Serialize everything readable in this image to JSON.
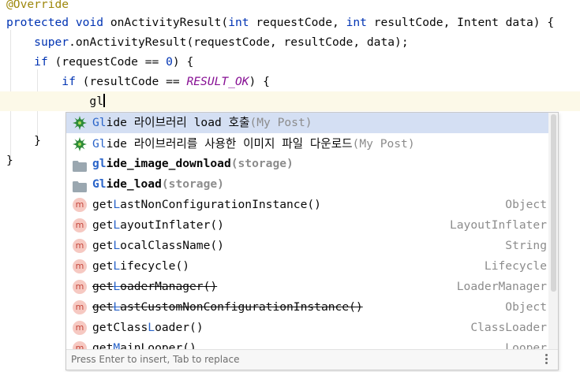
{
  "editor": {
    "lines": [
      {
        "parts": [
          {
            "t": "@Override",
            "c": "ann"
          }
        ]
      },
      {
        "parts": [
          {
            "t": "protected",
            "c": "kw"
          },
          {
            "t": " "
          },
          {
            "t": "void",
            "c": "kw"
          },
          {
            "t": " onActivityResult("
          },
          {
            "t": "int",
            "c": "kw"
          },
          {
            "t": " requestCode, "
          },
          {
            "t": "int",
            "c": "kw"
          },
          {
            "t": " resultCode, Intent data) {"
          }
        ]
      },
      {
        "parts": [
          {
            "t": "    "
          },
          {
            "t": "super",
            "c": "kw"
          },
          {
            "t": ".onActivityResult(requestCode, resultCode, data);"
          }
        ]
      },
      {
        "parts": [
          {
            "t": "    "
          },
          {
            "t": "if",
            "c": "kw"
          },
          {
            "t": " (requestCode == "
          },
          {
            "t": "0",
            "c": "kw"
          },
          {
            "t": ") {"
          }
        ]
      },
      {
        "parts": [
          {
            "t": "        "
          },
          {
            "t": "if",
            "c": "kw"
          },
          {
            "t": " (resultCode == "
          },
          {
            "t": "RESULT_OK",
            "c": "const"
          },
          {
            "t": ") {"
          }
        ]
      },
      {
        "parts": [
          {
            "t": "            gl"
          }
        ],
        "caret": true,
        "current": true
      },
      {
        "parts": [
          {
            "t": ""
          }
        ]
      },
      {
        "parts": [
          {
            "t": "    }"
          }
        ]
      },
      {
        "parts": [
          {
            "t": "}"
          }
        ]
      }
    ]
  },
  "completion": {
    "items": [
      {
        "icon": "glide-icon",
        "kind": "glide",
        "hl": "Gl",
        "name": "ide 라이브러리 load 호출",
        "note": "(My Post)",
        "type": ""
      },
      {
        "icon": "glide-icon",
        "kind": "glide",
        "hl": "Gl",
        "name": "ide 라이브러리를 사용한 이미지 파일 다운로드",
        "note": "(My Post)",
        "type": ""
      },
      {
        "icon": "folder-icon",
        "kind": "folder",
        "hl": "gl",
        "name": "ide_image_download",
        "note": "(storage)",
        "type": ""
      },
      {
        "icon": "folder-icon",
        "kind": "folder",
        "hl": "Gl",
        "name": "ide_load",
        "note": "(storage)",
        "type": ""
      },
      {
        "icon": "method-icon",
        "kind": "method",
        "pre": "get",
        "hl": "L",
        "name": "astNonConfigurationInstance",
        "params": "()",
        "type": "Object"
      },
      {
        "icon": "method-icon",
        "kind": "method",
        "pre": "get",
        "hl": "L",
        "name": "ayoutInflater",
        "params": "()",
        "type": "LayoutInflater"
      },
      {
        "icon": "method-icon",
        "kind": "method",
        "pre": "get",
        "hl": "L",
        "name": "ocalClassName",
        "params": "()",
        "type": "String"
      },
      {
        "icon": "method-icon",
        "kind": "method",
        "pre": "get",
        "hl": "L",
        "name": "ifecycle",
        "params": "()",
        "type": "Lifecycle"
      },
      {
        "icon": "method-icon",
        "kind": "method",
        "pre": "get",
        "hl": "L",
        "name": "oaderManager",
        "params": "()",
        "type": "LoaderManager",
        "deprecated": true
      },
      {
        "icon": "method-icon",
        "kind": "method",
        "pre": "get",
        "hl": "L",
        "name": "astCustomNonConfigurationInstance",
        "params": "()",
        "type": "Object",
        "deprecated": true
      },
      {
        "icon": "method-icon",
        "kind": "method",
        "pre": "getClass",
        "hl": "L",
        "name": "oader",
        "params": "()",
        "type": "ClassLoader"
      },
      {
        "icon": "method-icon",
        "kind": "method",
        "pre": "get",
        "hl": "M",
        "name": "ainLooper",
        "params": "()",
        "type": "Looper"
      }
    ],
    "footer_hint": "Press Enter to insert, Tab to replace",
    "method_glyph": "m"
  },
  "colors": {
    "selection": "#d4dff3",
    "current_line": "#fcf9e8",
    "keyword": "#0033b3",
    "annotation": "#9e880d",
    "match": "#2a64c9"
  }
}
